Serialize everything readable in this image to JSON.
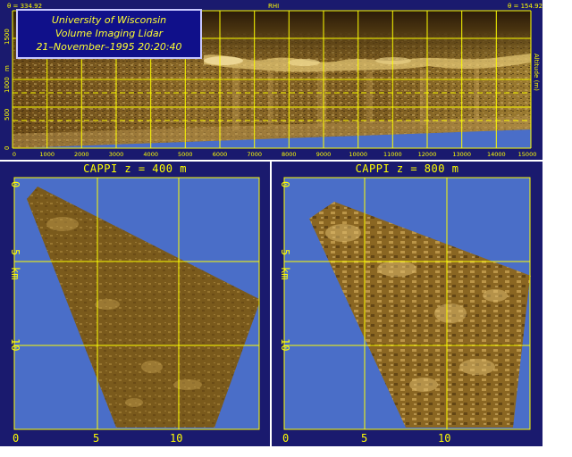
{
  "rhi": {
    "label": "RHI",
    "top_left_text": "θ = 334.92",
    "top_right_text": "θ = 154.92",
    "right_axis_label": "Altitude (m)",
    "y_tick_labels": [
      "0",
      "500",
      "1000",
      "1500"
    ],
    "x_tick_labels": [
      "0",
      "1000",
      "2000",
      "3000",
      "4000",
      "5000",
      "6000",
      "7000",
      "8000",
      "9000",
      "10000",
      "11000",
      "12000",
      "13000",
      "14000",
      "15000"
    ],
    "y_axis_unit": "m",
    "colors": {
      "background": "#4a6ec8",
      "frame": "#1a1a6e",
      "grid": "#ffff00",
      "aerosol": "#8a6420",
      "cloud": "#f0d890"
    }
  },
  "title_box": {
    "line1": "University of Wisconsin",
    "line2": "Volume Imaging Lidar",
    "line3": "21–November–1995 20:20:40"
  },
  "cappi_left": {
    "title": "CAPPI   z = 400 m",
    "y_tick_labels": [
      "0",
      "5",
      "10"
    ],
    "y_unit": "km",
    "x_tick_labels": [
      "0",
      "5",
      "10"
    ]
  },
  "cappi_right": {
    "title": "CAPPI   z = 800 m",
    "y_tick_labels": [
      "0",
      "5",
      "10"
    ],
    "y_unit": "km",
    "x_tick_labels": [
      "0",
      "5",
      "10"
    ]
  }
}
